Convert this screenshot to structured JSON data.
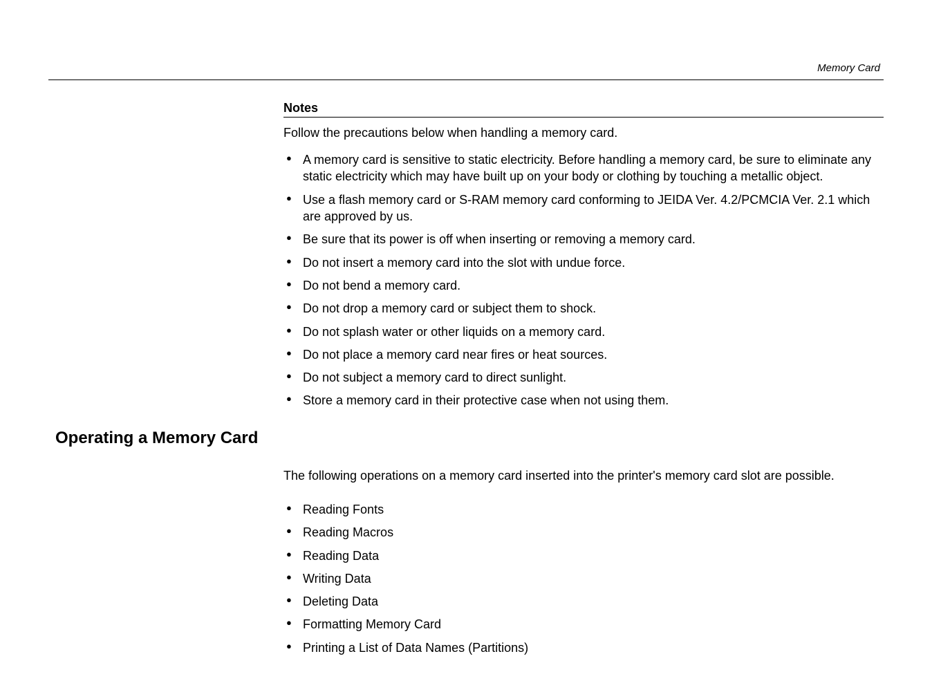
{
  "header": {
    "running_title": "Memory Card"
  },
  "notes": {
    "heading": "Notes",
    "intro": "Follow the precautions below when handling a memory card.",
    "items": [
      "A memory card is sensitive to static electricity.  Before handling a memory card, be sure to eliminate any static electricity which may have built up on your body or clothing by touching a metallic object.",
      "Use a flash memory card or S-RAM memory card conforming to JEIDA Ver. 4.2/PCMCIA Ver. 2.1 which are approved by us.",
      "Be sure that its power is off when inserting or removing a memory card.",
      "Do not insert a memory card into the slot with undue force.",
      "Do not bend a memory card.",
      "Do not drop a memory card or subject them to shock.",
      "Do not splash water or other liquids on a memory card.",
      "Do not place a memory card near fires or heat sources.",
      "Do not subject a memory card to direct sunlight.",
      "Store a memory card in their protective case when not using them."
    ]
  },
  "section": {
    "heading": "Operating a Memory Card",
    "intro": "The following operations on a memory card inserted into the printer's memory card slot are possible.",
    "items": [
      "Reading Fonts",
      "Reading Macros",
      "Reading Data",
      "Writing Data",
      "Deleting Data",
      "Formatting Memory Card",
      "Printing a List of Data Names (Partitions)"
    ]
  }
}
